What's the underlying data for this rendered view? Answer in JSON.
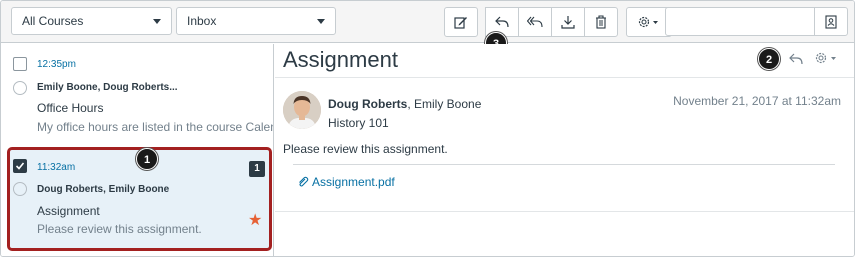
{
  "toolbar": {
    "course_filter": "All Courses",
    "mailbox_filter": "Inbox",
    "buttons": [
      "compose-icon",
      "reply-icon",
      "reply-all-icon",
      "archive-icon",
      "delete-icon",
      "gear-icon"
    ],
    "search_placeholder": ""
  },
  "messages": [
    {
      "time": "12:35pm",
      "participants": "Emily Boone, Doug Roberts...",
      "subject": "Office Hours",
      "preview": "My office hours are listed in the course Calend",
      "selected": false
    },
    {
      "time": "11:32am",
      "participants": "Doug Roberts, Emily Boone",
      "subject": "Assignment",
      "preview": "Please review this assignment.",
      "selected": true,
      "unread_count": "1",
      "starred": true
    }
  ],
  "detail": {
    "title": "Assignment",
    "sender_bold": "Doug Roberts",
    "sender_rest": ", Emily Boone",
    "course": "History 101",
    "date": "November 21, 2017 at 11:32am",
    "body": "Please review this assignment.",
    "attachment": "Assignment.pdf"
  },
  "callouts": [
    "1",
    "2",
    "3"
  ],
  "colors": {
    "link": "#0770a3",
    "selected_bg": "#e7f1f8",
    "highlight_border": "#a32020",
    "star": "#e66135"
  }
}
